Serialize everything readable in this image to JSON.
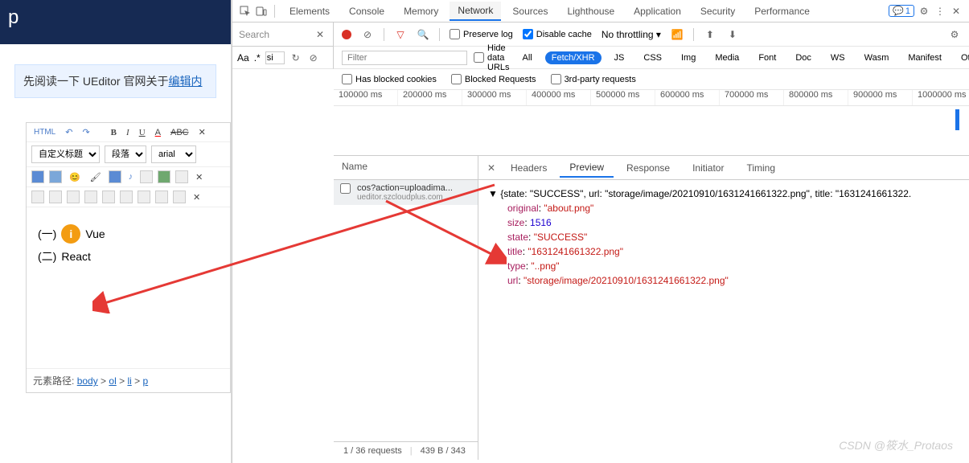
{
  "left": {
    "header_char": "p",
    "note_prefix": "先阅读一下 UEditor 官网关于",
    "note_link": "编辑内",
    "toolbar": {
      "html": "HTML",
      "b": "B",
      "i": "I",
      "u": "U",
      "a": "A",
      "abc": "ABC",
      "sel1": "自定义标题",
      "sel2": "段落",
      "sel3": "arial"
    },
    "list": {
      "item1_num": "(一)",
      "item1_txt": "Vue",
      "item2_num": "(二)",
      "item2_txt": "React",
      "icon_char": "i"
    },
    "path_label": "元素路径:",
    "path_items": [
      "body",
      "ol",
      "li",
      "p"
    ]
  },
  "dev": {
    "tabs": [
      "Elements",
      "Console",
      "Memory",
      "Network",
      "Sources",
      "Lighthouse",
      "Application",
      "Security",
      "Performance"
    ],
    "active_tab": "Network",
    "badge": "1",
    "search_label": "Search",
    "search_sub": {
      "aa": "Aa",
      "dot": ".*",
      "si": "si"
    },
    "preserve": "Preserve log",
    "disable": "Disable cache",
    "throttle": "No throttling",
    "filter_placeholder": "Filter",
    "hide": "Hide data URLs",
    "pills": [
      "All",
      "Fetch/XHR",
      "JS",
      "CSS",
      "Img",
      "Media",
      "Font",
      "Doc",
      "WS",
      "Wasm",
      "Manifest",
      "Other"
    ],
    "active_pill": "Fetch/XHR",
    "hbc": "Has blocked cookies",
    "br": "Blocked Requests",
    "tpr": "3rd-party requests",
    "timeline": [
      "100000 ms",
      "200000 ms",
      "300000 ms",
      "400000 ms",
      "500000 ms",
      "600000 ms",
      "700000 ms",
      "800000 ms",
      "900000 ms",
      "1000000 ms"
    ],
    "name_header": "Name",
    "req": {
      "main": "cos?action=uploadima...",
      "sub": "ueditor.szcloudplus.com"
    },
    "status": {
      "requests": "1 / 36 requests",
      "size": "439 B / 343"
    },
    "detail_tabs": [
      "Headers",
      "Preview",
      "Response",
      "Initiator",
      "Timing"
    ],
    "active_detail": "Preview",
    "json_header": "{state: \"SUCCESS\", url: \"storage/image/20210910/1631241661322.png\", title: \"1631241661322.",
    "json": {
      "original": "\"about.png\"",
      "size": "1516",
      "state": "\"SUCCESS\"",
      "title": "\"1631241661322.png\"",
      "type": "\"..png\"",
      "url": "\"storage/image/20210910/1631241661322.png\""
    }
  },
  "watermark": "CSDN @筱水_Protaos"
}
